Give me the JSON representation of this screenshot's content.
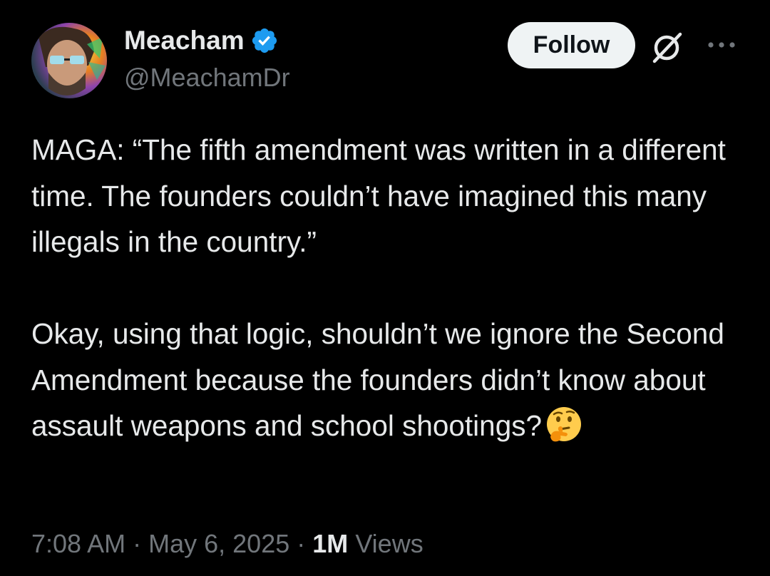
{
  "author": {
    "display_name": "Meacham",
    "handle": "@MeachamDr",
    "verified": true,
    "avatar_icon": "person-avatar"
  },
  "actions": {
    "follow_label": "Follow",
    "grok_icon": "grok-icon",
    "more_icon": "more-icon"
  },
  "tweet": {
    "paragraph_1": "MAGA: “The fifth amendment was written in a different time. The founders couldn’t have imagined this many illegals in the country.”",
    "paragraph_2": "Okay, using that logic, shouldn’t we ignore the Second Amendment because the founders didn’t know about assault weapons and school shootings?",
    "emoji": "thinking-face-emoji"
  },
  "meta": {
    "time": "7:08 AM",
    "separator": "·",
    "date": "May 6, 2025",
    "views_count": "1M",
    "views_label": "Views"
  },
  "colors": {
    "background": "#000000",
    "primary_text": "#e7e9ea",
    "secondary_text": "#71767b",
    "verified_badge": "#1d9bf0",
    "follow_button_bg": "#eff3f4",
    "follow_button_text": "#0f1419"
  }
}
